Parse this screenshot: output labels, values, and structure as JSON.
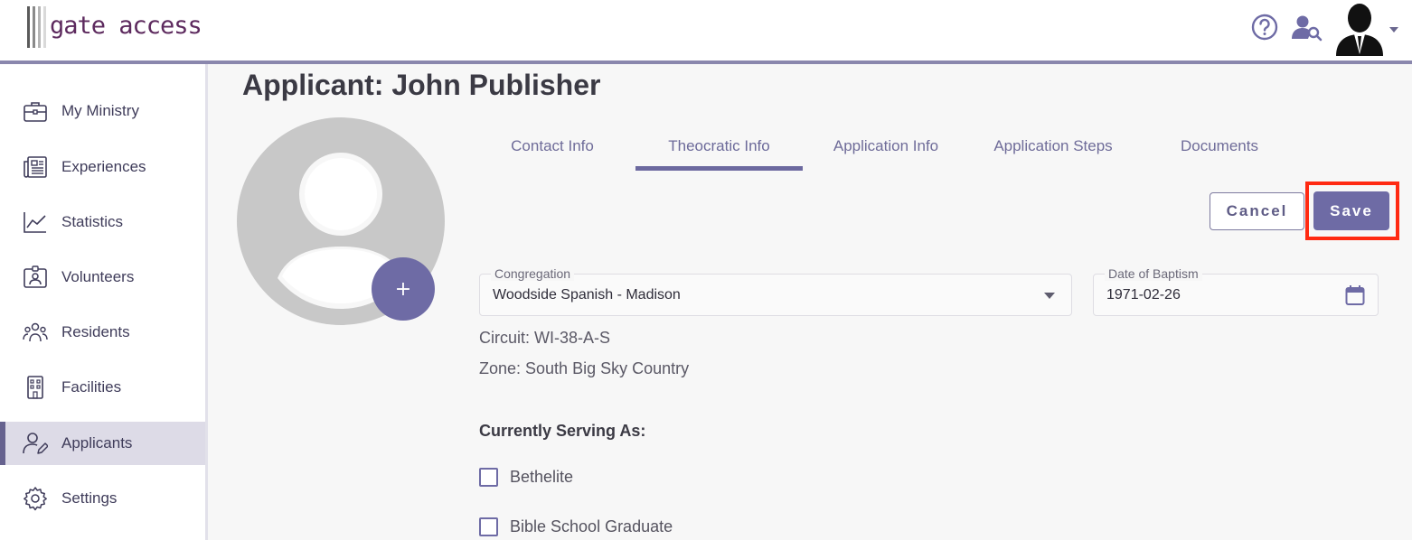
{
  "header": {
    "logo_text": "gate access",
    "help_icon": "help-circle-icon",
    "user_search_icon": "user-search-icon",
    "avatar_icon": "user-avatar-icon",
    "brand_color": "#5d2a5e",
    "accent_color": "#6e6ba5"
  },
  "sidebar": {
    "items": [
      {
        "label": "My Ministry",
        "icon": "briefcase-icon"
      },
      {
        "label": "Experiences",
        "icon": "newspaper-icon"
      },
      {
        "label": "Statistics",
        "icon": "line-chart-icon"
      },
      {
        "label": "Volunteers",
        "icon": "id-badge-icon"
      },
      {
        "label": "Residents",
        "icon": "people-group-icon"
      },
      {
        "label": "Facilities",
        "icon": "building-icon"
      },
      {
        "label": "Applicants",
        "icon": "user-edit-icon",
        "active": true
      },
      {
        "label": "Settings",
        "icon": "gear-icon"
      }
    ]
  },
  "main": {
    "title": "Applicant: John Publisher",
    "add_photo_label": "+",
    "tabs": [
      {
        "label": "Contact Info"
      },
      {
        "label": "Theocratic Info",
        "active": true
      },
      {
        "label": "Application Info"
      },
      {
        "label": "Application Steps"
      },
      {
        "label": "Documents"
      }
    ],
    "actions": {
      "cancel_label": "Cancel",
      "save_label": "Save"
    },
    "congregation": {
      "label": "Congregation",
      "value": "Woodside Spanish - Madison"
    },
    "baptism": {
      "label": "Date of Baptism",
      "value": "1971-02-26"
    },
    "circuit": "Circuit: WI-38-A-S",
    "zone": "Zone: South Big Sky Country",
    "serving_heading": "Currently Serving As:",
    "serving_options": [
      {
        "label": "Bethelite",
        "checked": false
      },
      {
        "label": "Bible School Graduate",
        "checked": false
      }
    ]
  }
}
